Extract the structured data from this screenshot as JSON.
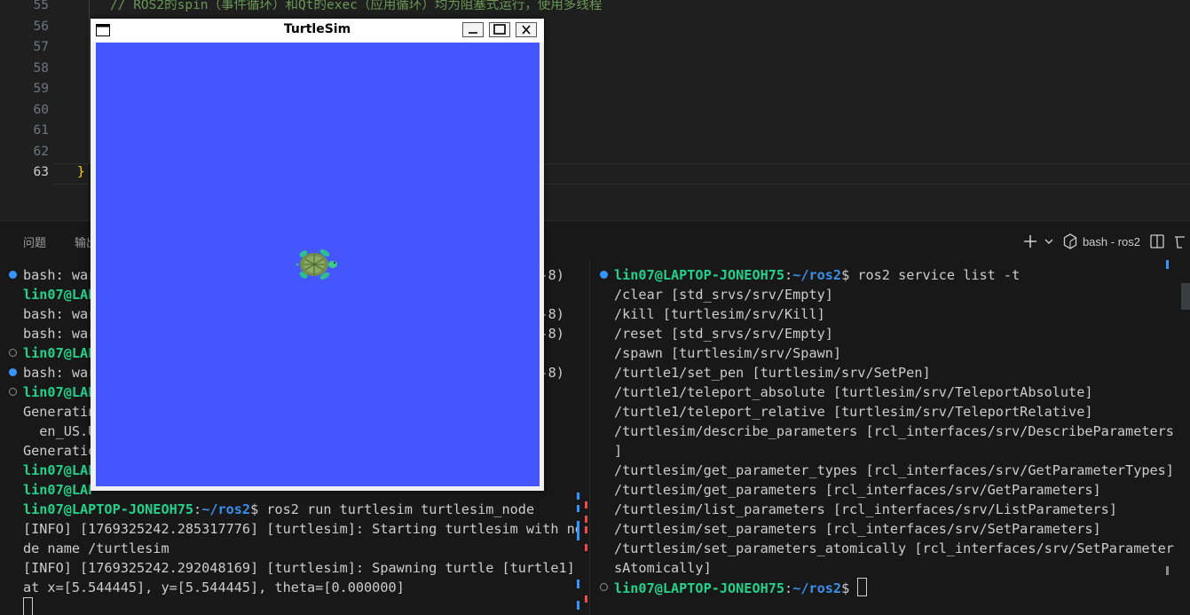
{
  "editor": {
    "lines": [
      {
        "num": "55",
        "text": "// ROS2的spin（事件循环）和Qt的exec（应用循环）均为阻塞式运行，使用多线程",
        "kind": "comment"
      },
      {
        "num": "56",
        "text": "",
        "kind": "plain"
      },
      {
        "num": "57",
        "text": "",
        "kind": "plain"
      },
      {
        "num": "58",
        "text": "",
        "kind": "plain"
      },
      {
        "num": "59",
        "text": "",
        "kind": "plain"
      },
      {
        "num": "60",
        "text": "",
        "kind": "plain"
      },
      {
        "num": "61",
        "text": "",
        "kind": "plain"
      },
      {
        "num": "62",
        "text": "",
        "kind": "plain"
      },
      {
        "num": "63",
        "text": "}",
        "kind": "brace"
      }
    ]
  },
  "panel": {
    "tabs": [
      "问题",
      "输出"
    ],
    "terminal_name": "bash - ros2",
    "add_icon": "plus-icon",
    "colors": {
      "user": "#23d18b",
      "path": "#3b8eea"
    }
  },
  "turtlesim": {
    "title": "TurtleSim",
    "background": "#4556ff",
    "turtle": {
      "x": 5.544445,
      "y": 5.544445,
      "theta": 0.0
    }
  },
  "term_left": {
    "lines": [
      {
        "dot": "filled",
        "segs": [
          [
            "plain",
            "bash: war"
          ],
          [
            "gap",
            ""
          ],
          [
            "plain",
            "-8)"
          ]
        ]
      },
      {
        "dot": "",
        "segs": [
          [
            "user",
            "lin07@LAP"
          ]
        ]
      },
      {
        "dot": "",
        "segs": [
          [
            "plain",
            "bash: war"
          ],
          [
            "gap",
            ""
          ],
          [
            "plain",
            "-8)"
          ]
        ]
      },
      {
        "dot": "",
        "segs": [
          [
            "plain",
            "bash: war"
          ],
          [
            "gap",
            ""
          ],
          [
            "plain",
            "-8)"
          ]
        ]
      },
      {
        "dot": "hollow",
        "segs": [
          [
            "user",
            "lin07@LAP"
          ]
        ]
      },
      {
        "dot": "filled",
        "segs": [
          [
            "plain",
            "bash: war"
          ],
          [
            "gap",
            ""
          ],
          [
            "plain",
            "-8)"
          ]
        ]
      },
      {
        "dot": "hollow",
        "segs": [
          [
            "user",
            "lin07@LAP"
          ]
        ]
      },
      {
        "dot": "",
        "segs": [
          [
            "plain",
            "Generatin"
          ]
        ]
      },
      {
        "dot": "",
        "segs": [
          [
            "plain",
            "  en_US.U"
          ]
        ]
      },
      {
        "dot": "",
        "segs": [
          [
            "plain",
            "Generatio"
          ]
        ]
      },
      {
        "dot": "",
        "segs": [
          [
            "user",
            "lin07@LAP"
          ]
        ]
      },
      {
        "dot": "",
        "segs": [
          [
            "user",
            "lin07@LAP"
          ]
        ]
      },
      {
        "dot": "",
        "segs": [
          [
            "user",
            "lin07@LAPTOP-JONEOH75"
          ],
          [
            "plain",
            ":"
          ],
          [
            "path",
            "~/ros2"
          ],
          [
            "plain",
            "$ ros2 run turtlesim turtlesim_node"
          ]
        ]
      },
      {
        "dot": "",
        "segs": [
          [
            "plain",
            "[INFO] [1769325242.285317776] [turtlesim]: Starting turtlesim with no"
          ]
        ]
      },
      {
        "dot": "",
        "segs": [
          [
            "plain",
            "de name /turtlesim"
          ]
        ]
      },
      {
        "dot": "",
        "segs": [
          [
            "plain",
            "[INFO] [1769325242.292048169] [turtlesim]: Spawning turtle [turtle1]"
          ]
        ]
      },
      {
        "dot": "",
        "segs": [
          [
            "plain",
            "at x=[5.544445], y=[5.544445], theta=[0.000000]"
          ]
        ]
      },
      {
        "dot": "",
        "segs": [
          [
            "cursor",
            ""
          ]
        ]
      }
    ]
  },
  "term_right": {
    "lines": [
      {
        "dot": "filled",
        "segs": [
          [
            "user",
            "lin07@LAPTOP-JONEOH75"
          ],
          [
            "plain",
            ":"
          ],
          [
            "path",
            "~/ros2"
          ],
          [
            "plain",
            "$ ros2 service list -t"
          ]
        ]
      },
      {
        "dot": "",
        "segs": [
          [
            "plain",
            "/clear [std_srvs/srv/Empty]"
          ]
        ]
      },
      {
        "dot": "",
        "segs": [
          [
            "plain",
            "/kill [turtlesim/srv/Kill]"
          ]
        ]
      },
      {
        "dot": "",
        "segs": [
          [
            "plain",
            "/reset [std_srvs/srv/Empty]"
          ]
        ]
      },
      {
        "dot": "",
        "segs": [
          [
            "plain",
            "/spawn [turtlesim/srv/Spawn]"
          ]
        ]
      },
      {
        "dot": "",
        "segs": [
          [
            "plain",
            "/turtle1/set_pen [turtlesim/srv/SetPen]"
          ]
        ]
      },
      {
        "dot": "",
        "segs": [
          [
            "plain",
            "/turtle1/teleport_absolute [turtlesim/srv/TeleportAbsolute]"
          ]
        ]
      },
      {
        "dot": "",
        "segs": [
          [
            "plain",
            "/turtle1/teleport_relative [turtlesim/srv/TeleportRelative]"
          ]
        ]
      },
      {
        "dot": "",
        "segs": [
          [
            "plain",
            "/turtlesim/describe_parameters [rcl_interfaces/srv/DescribeParameters"
          ]
        ]
      },
      {
        "dot": "",
        "segs": [
          [
            "plain",
            "]"
          ]
        ]
      },
      {
        "dot": "",
        "segs": [
          [
            "plain",
            "/turtlesim/get_parameter_types [rcl_interfaces/srv/GetParameterTypes]"
          ]
        ]
      },
      {
        "dot": "",
        "segs": [
          [
            "plain",
            "/turtlesim/get_parameters [rcl_interfaces/srv/GetParameters]"
          ]
        ]
      },
      {
        "dot": "",
        "segs": [
          [
            "plain",
            "/turtlesim/list_parameters [rcl_interfaces/srv/ListParameters]"
          ]
        ]
      },
      {
        "dot": "",
        "segs": [
          [
            "plain",
            "/turtlesim/set_parameters [rcl_interfaces/srv/SetParameters]"
          ]
        ]
      },
      {
        "dot": "",
        "segs": [
          [
            "plain",
            "/turtlesim/set_parameters_atomically [rcl_interfaces/srv/SetParameter"
          ]
        ]
      },
      {
        "dot": "",
        "segs": [
          [
            "plain",
            "sAtomically]"
          ]
        ]
      },
      {
        "dot": "hollow",
        "segs": [
          [
            "user",
            "lin07@LAPTOP-JONEOH75"
          ],
          [
            "plain",
            ":"
          ],
          [
            "path",
            "~/ros2"
          ],
          [
            "plain",
            "$ "
          ],
          [
            "cursor",
            ""
          ]
        ]
      }
    ]
  }
}
